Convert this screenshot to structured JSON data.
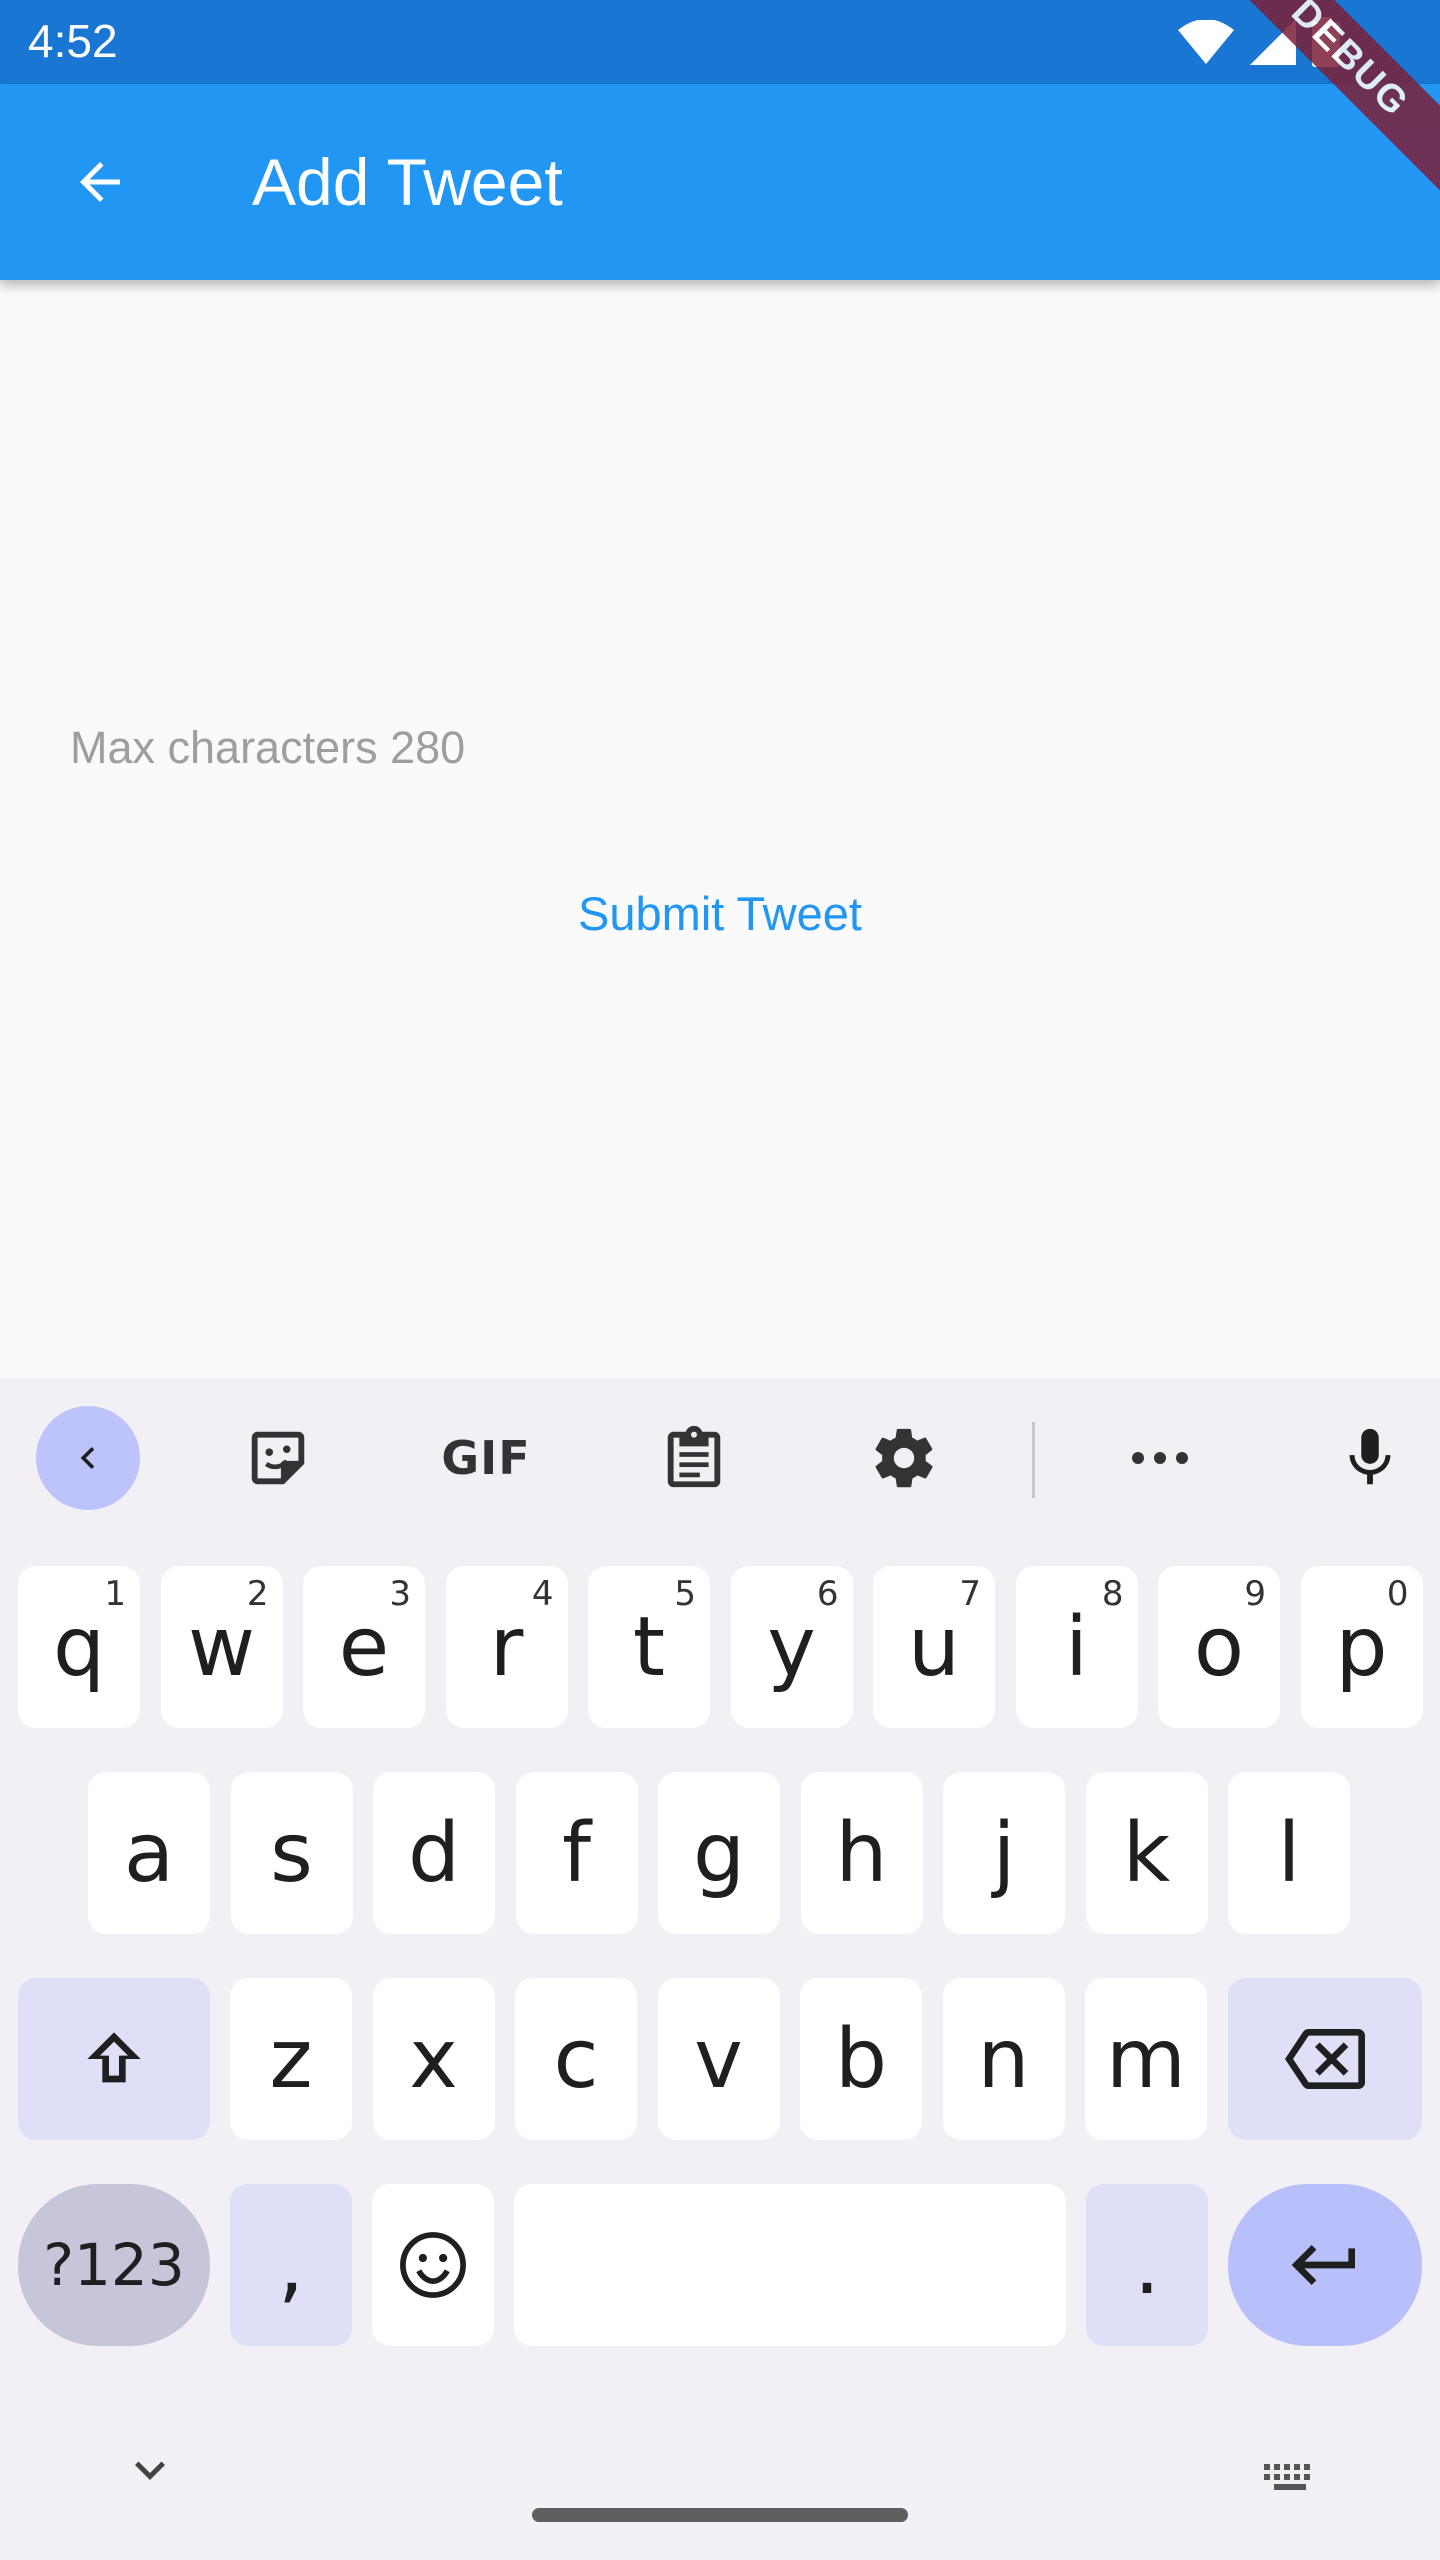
{
  "status_bar": {
    "time": "4:52"
  },
  "app_bar": {
    "title": "Add Tweet"
  },
  "debug_banner": "DEBUG",
  "form": {
    "hint": "Max characters 280",
    "submit_label": "Submit Tweet"
  },
  "keyboard": {
    "toolbar": [
      "back-icon",
      "sticker-icon",
      "GIF",
      "clipboard-icon",
      "gear-icon",
      "more-icon",
      "mic-icon"
    ],
    "gif_label": "GIF",
    "row1": [
      {
        "k": "q",
        "n": "1"
      },
      {
        "k": "w",
        "n": "2"
      },
      {
        "k": "e",
        "n": "3"
      },
      {
        "k": "r",
        "n": "4"
      },
      {
        "k": "t",
        "n": "5"
      },
      {
        "k": "y",
        "n": "6"
      },
      {
        "k": "u",
        "n": "7"
      },
      {
        "k": "i",
        "n": "8"
      },
      {
        "k": "o",
        "n": "9"
      },
      {
        "k": "p",
        "n": "0"
      }
    ],
    "row2": [
      "a",
      "s",
      "d",
      "f",
      "g",
      "h",
      "j",
      "k",
      "l"
    ],
    "row3": [
      "z",
      "x",
      "c",
      "v",
      "b",
      "n",
      "m"
    ],
    "symbols_label": "?123",
    "comma": ",",
    "period": "."
  },
  "colors": {
    "app_bar": "#2196f3",
    "status_bar": "#1976d2",
    "accent": "#2196f3"
  }
}
